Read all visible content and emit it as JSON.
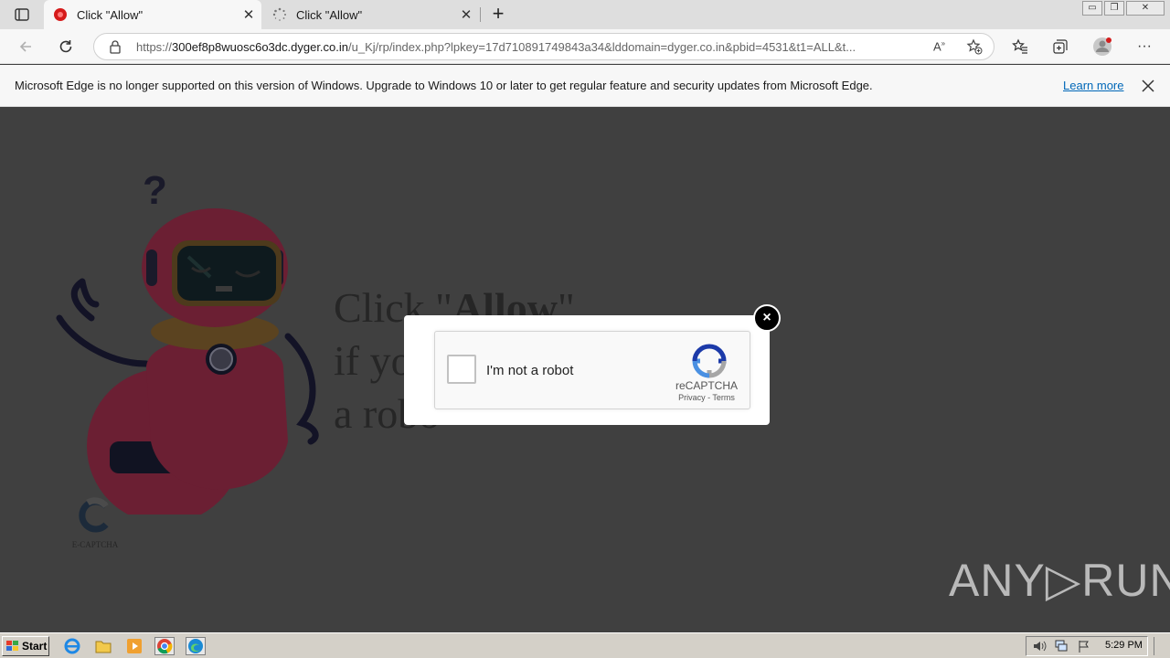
{
  "tabs": [
    {
      "title": "Click \"Allow\"",
      "active": true
    },
    {
      "title": "Click \"Allow\"",
      "active": false
    }
  ],
  "window": {
    "min": "▭",
    "max": "❐",
    "close": "✕"
  },
  "address": {
    "url_prefix": "https://",
    "url_host": "300ef8p8wuosc6o3dc.dyger.co.in",
    "url_rest": "/u_Kj/rp/index.php?lpkey=17d710891749843a34&lddomain=dyger.co.in&pbid=4531&t1=ALL&t..."
  },
  "infobar": {
    "message": "Microsoft Edge is no longer supported on this version of Windows. Upgrade to Windows 10 or later to get regular feature and security updates from Microsoft Edge.",
    "learn_more": "Learn more"
  },
  "page": {
    "headline_line1_pre": "Click \"",
    "headline_line1_bold": "Allow",
    "headline_line1_post": "\"",
    "headline_line2": "if yo",
    "headline_line3": "a robo",
    "ecaptcha_label": "E-CAPTCHA"
  },
  "modal": {
    "close": "×",
    "checkbox_label": "I'm not a robot",
    "brand": "reCAPTCHA",
    "links": "Privacy - Terms"
  },
  "watermark": "ANY▷RUN",
  "taskbar": {
    "start": "Start",
    "clock": "5:29 PM"
  },
  "colors": {
    "robot": "#6b1f33",
    "accent_link": "#0067b8",
    "overlay": "#404040"
  }
}
